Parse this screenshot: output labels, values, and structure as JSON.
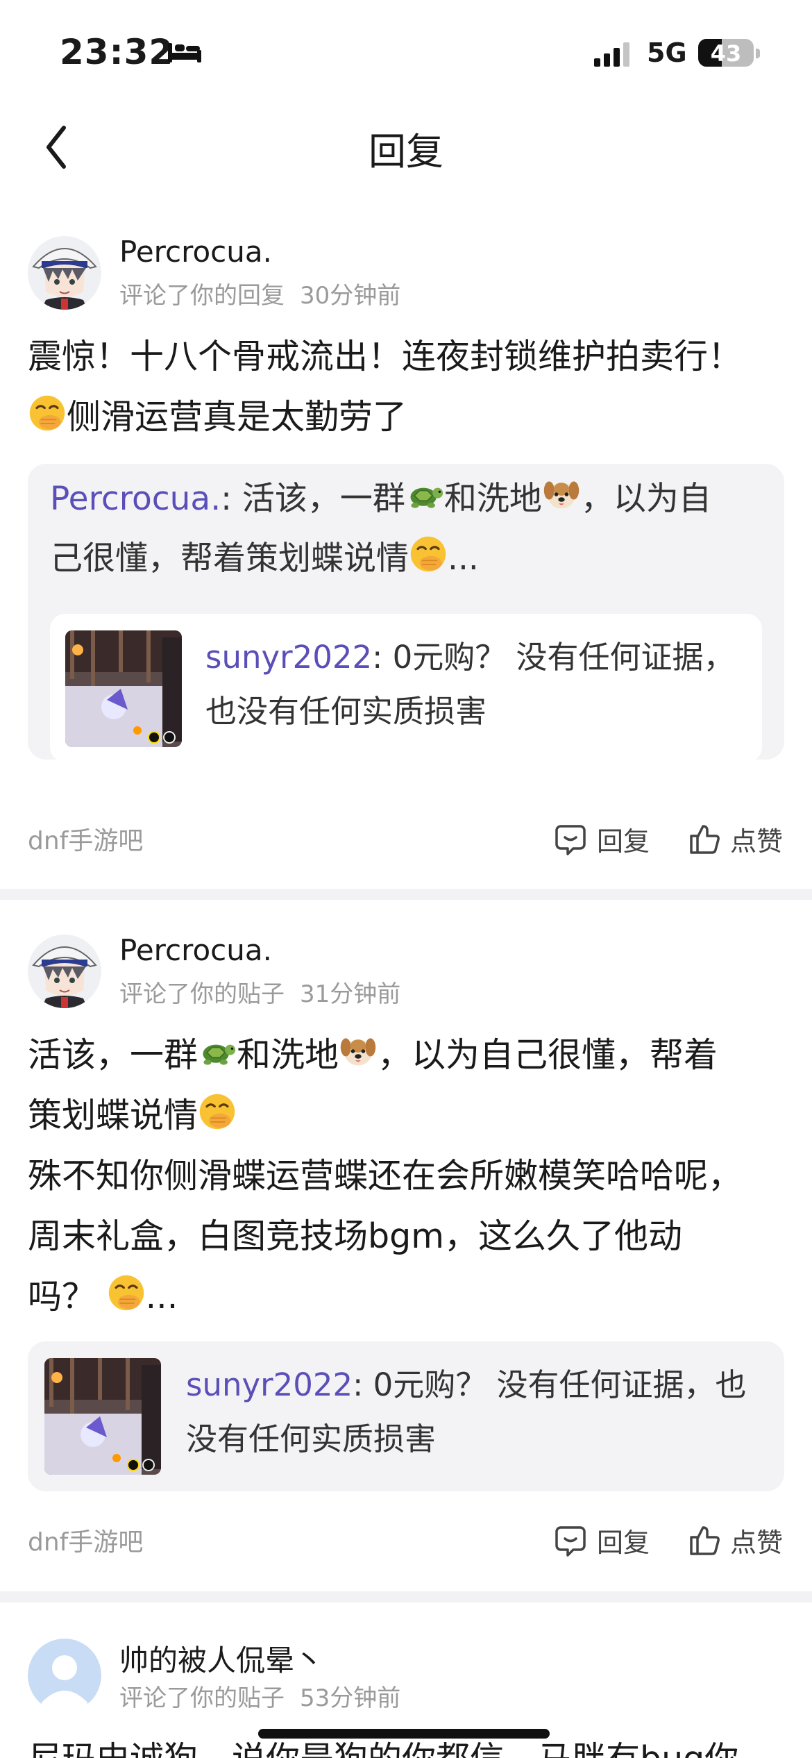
{
  "status_bar": {
    "time": "23:32",
    "network": "5G",
    "battery": "43",
    "battery_level": 0.43
  },
  "header": {
    "title": "回复"
  },
  "notifications": [
    {
      "username": "Percrocua.",
      "action": "评论了你的回复",
      "time": "30分钟前",
      "body_line1": "震惊！十八个骨戒流出！连夜封锁维护拍卖行！",
      "body_line2": "侧滑运营真是太勤劳了",
      "quote_author": "Percrocua.",
      "quote_sep": ": ",
      "quote_part1": "活该，一群",
      "quote_part2": "和洗地",
      "quote_part3": "，以为自",
      "quote_line2": "己很懂，帮着策划蝶说情",
      "quote_ellipsis": "...",
      "inner_author": "sunyr2022",
      "inner_sep": ": ",
      "inner_line1": "0元购？ 没有任何证据，",
      "inner_line2": "也没有任何实质损害",
      "forum": "dnf手游吧",
      "reply_label": "回复",
      "like_label": "点赞"
    },
    {
      "username": "Percrocua.",
      "action": "评论了你的贴子",
      "time": "31分钟前",
      "body_part1": "活该，一群",
      "body_part2": "和洗地",
      "body_part3": "，以为自己很懂，帮着",
      "body_line2": "策划蝶说情",
      "body_line3": "殊不知你侧滑蝶运营蝶还在会所嫩模笑哈哈呢，",
      "body_line4": "周末礼盒，白图竞技场bgm，这么久了他动",
      "body_line5": "吗？",
      "body_ellipsis": "...",
      "inner_author": "sunyr2022",
      "inner_sep": ": ",
      "inner_line1": "0元购？ 没有任何证据，也",
      "inner_line2": "没有任何实质损害",
      "forum": "dnf手游吧",
      "reply_label": "回复",
      "like_label": "点赞"
    },
    {
      "username": "帅的被人侃晕丶",
      "action": "评论了你的贴子",
      "time": "53分钟前",
      "body_line1": "尼玛史诚狗，说你是狗的你都信，马胖有bug你"
    }
  ],
  "icons": {
    "status_bed": "bed-icon",
    "signal": "signal-icon",
    "back": "chevron-left-icon",
    "reply": "comment-bubble-icon",
    "like": "thumbs-up-icon",
    "turtle": "turtle-emoji",
    "dog": "dog-face-emoji",
    "smirk": "hand-over-mouth-emoji"
  },
  "colors": {
    "link": "#5a4fb8",
    "meta": "#9a9a9a",
    "quote_bg": "#f3f3f5",
    "divider": "#f2f2f4"
  }
}
